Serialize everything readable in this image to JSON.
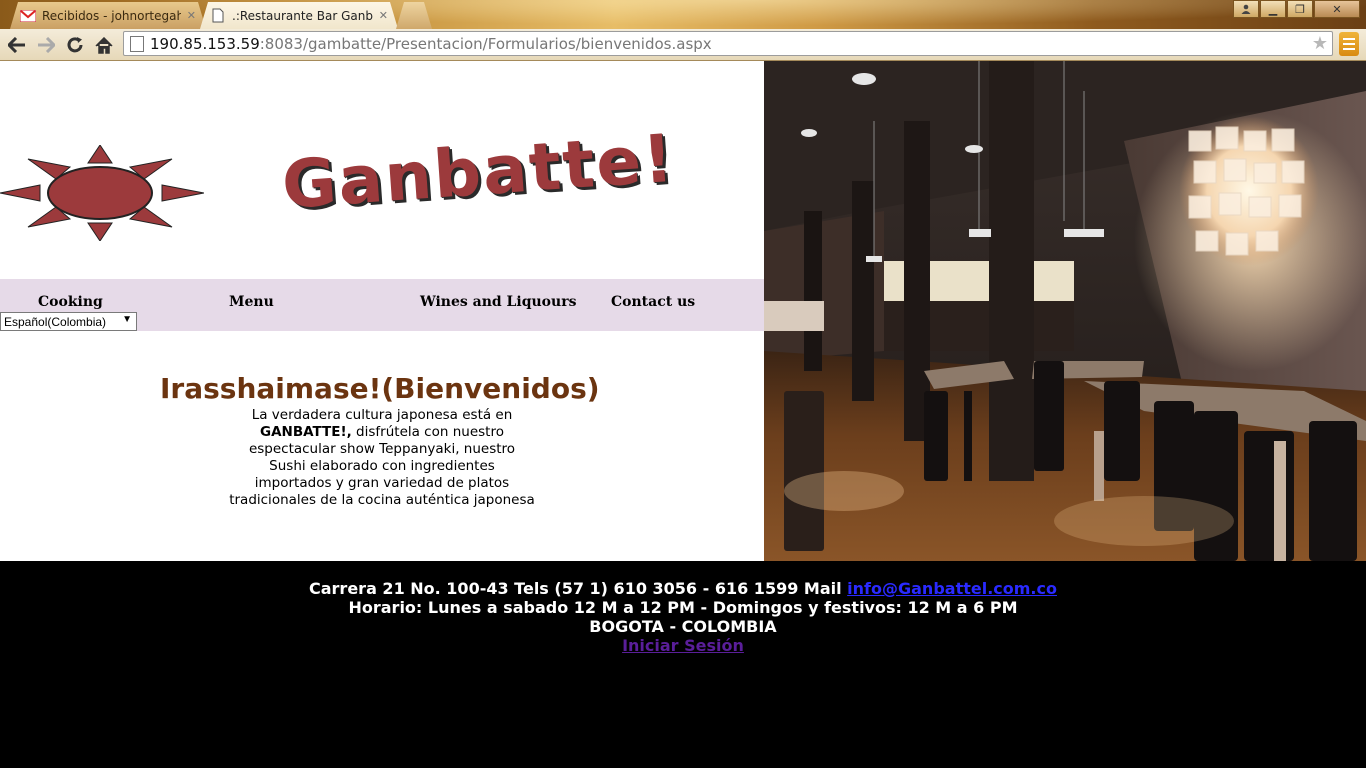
{
  "browser": {
    "tabs": [
      {
        "title": "Recibidos - johnortegahj@",
        "state": "inactive",
        "icon": "gmail-icon"
      },
      {
        "title": ".:Restaurante Bar Ganbatte",
        "state": "active",
        "icon": "page-icon"
      }
    ],
    "url_host": "190.85.153.59",
    "url_rest": ":8083/gambatte/Presentacion/Formularios/bienvenidos.aspx"
  },
  "site": {
    "brand": "Ganbatte!",
    "menu": [
      "Cooking",
      "Menu",
      "Wines and Liquours",
      "Contact us"
    ],
    "language_selected": "Español(Colombia)",
    "welcome_title": "Irasshaimase!(Bienvenidos)",
    "intro": {
      "line1": "La verdadera cultura japonesa está en",
      "bold": "GANBATTE!,",
      "line2_rest": " disfrútela con nuestro",
      "line3": "espectacular show Teppanyaki, nuestro",
      "line4": "Sushi elaborado con ingredientes",
      "line5": "importados y gran variedad de platos",
      "line6": "tradicionales de la cocina auténtica japonesa"
    },
    "footer": {
      "address_text": "Carrera 21 No. 100-43 Tels (57 1) 610 3056 - 616 1599 Mail ",
      "email": "info@Ganbattel.com.co",
      "schedule": "Horario: Lunes a sabado 12 M a 12 PM - Domingos y festivos: 12 M a 6 PM",
      "city": "BOGOTA - COLOMBIA",
      "login": "Iniciar Sesión"
    }
  },
  "colors": {
    "brand_red": "#9c3a3c",
    "menu_bg": "#e6dae8",
    "welcome_brown": "#6b3410"
  }
}
